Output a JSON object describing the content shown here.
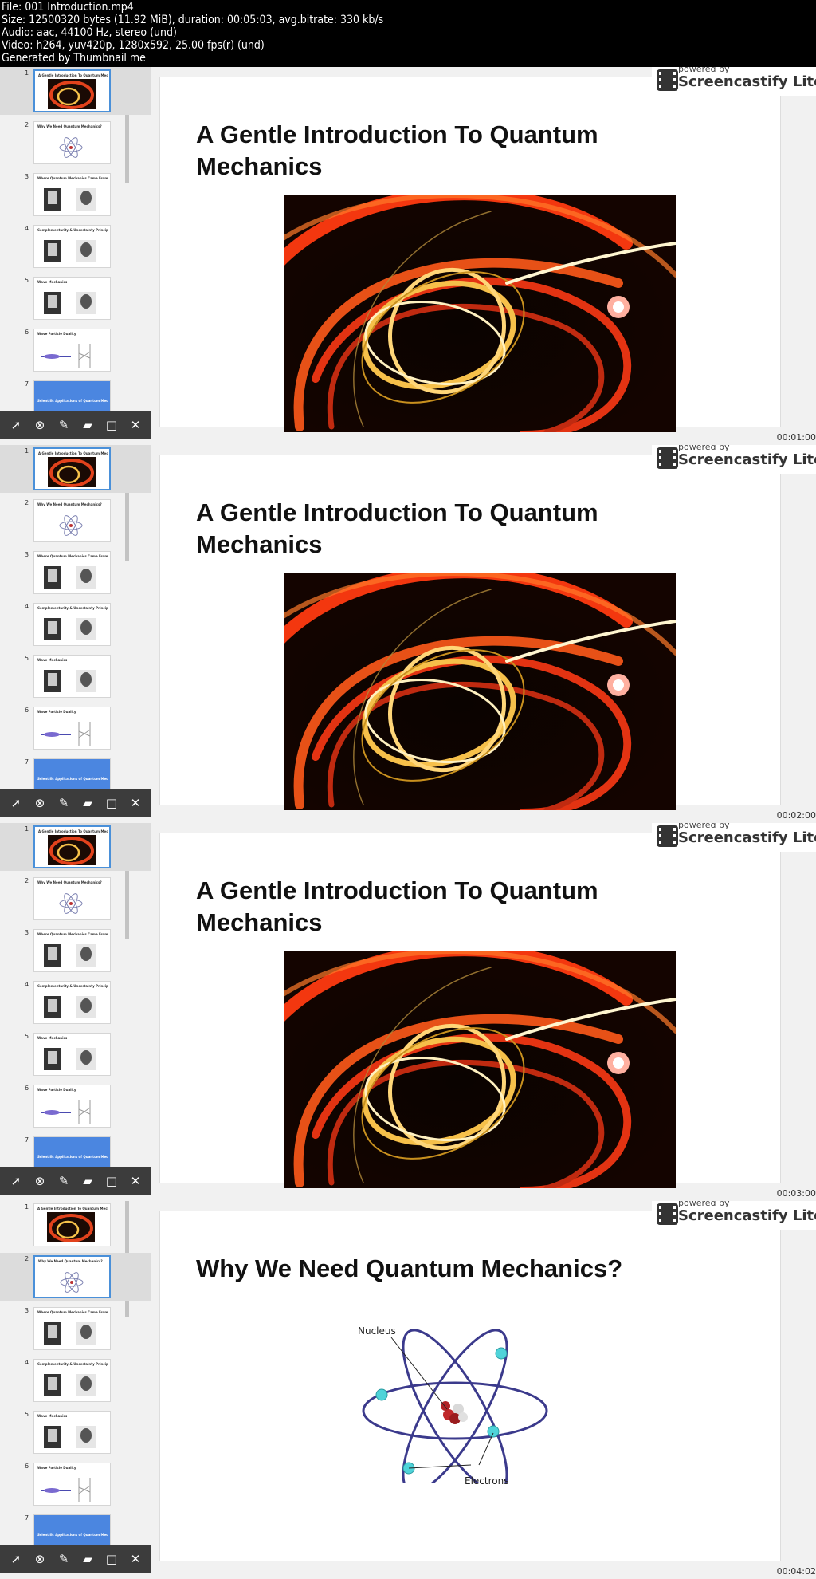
{
  "file_info": [
    "File: 001 Introduction.mp4",
    "Size: 12500320 bytes (11.92 MiB), duration: 00:05:03, avg.bitrate: 330 kb/s",
    "Audio: aac, 44100 Hz, stereo (und)",
    "Video: h264, yuv420p, 1280x592, 25.00 fps(r) (und)",
    "Generated by Thumbnail me"
  ],
  "badge": {
    "small": "powered by",
    "big": "Screencastify Lite"
  },
  "thumbnails": [
    {
      "num": "1",
      "title": "A Gentle Introduction To Quantum Mechanics"
    },
    {
      "num": "2",
      "title": "Why We Need Quantum Mechanics?"
    },
    {
      "num": "3",
      "title": "Where Quantum Mechanics Came From?"
    },
    {
      "num": "4",
      "title": "Complementarity & Uncertainty Principle"
    },
    {
      "num": "5",
      "title": "Wave Mechanics"
    },
    {
      "num": "6",
      "title": "Wave Particle Duality"
    },
    {
      "num": "7",
      "title": "Scientific Applications of Quantum Mechanics"
    }
  ],
  "tools": [
    {
      "name": "pointer-tool",
      "glyph": "➚"
    },
    {
      "name": "erase-tool",
      "glyph": "⊗"
    },
    {
      "name": "pen-tool",
      "glyph": "✎"
    },
    {
      "name": "highlighter-tool",
      "glyph": "▰"
    },
    {
      "name": "rectangle-tool",
      "glyph": "□"
    },
    {
      "name": "close-tool",
      "glyph": "✕"
    }
  ],
  "frames": [
    {
      "active_slide": 1,
      "title": "A Gentle Introduction To Quantum Mechanics",
      "timecode": "00:01:00"
    },
    {
      "active_slide": 1,
      "title": "A Gentle Introduction To Quantum Mechanics",
      "timecode": "00:02:00"
    },
    {
      "active_slide": 1,
      "title": "A Gentle Introduction To Quantum Mechanics",
      "timecode": "00:03:00"
    },
    {
      "active_slide": 2,
      "title": "Why We Need Quantum Mechanics?",
      "timecode": "00:04:02"
    }
  ],
  "atom_labels": {
    "nucleus": "Nucleus",
    "electrons": "Electrons"
  }
}
